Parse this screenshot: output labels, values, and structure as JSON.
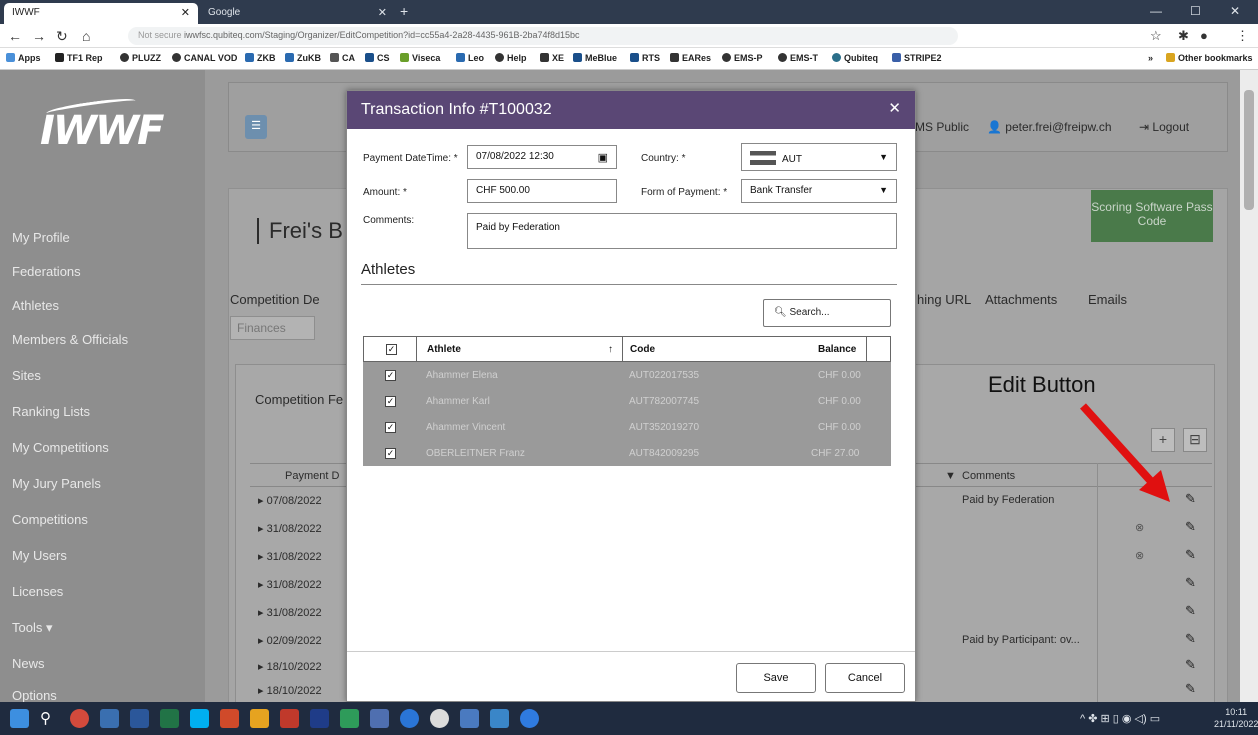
{
  "browser": {
    "tabs": [
      {
        "label": "IWWF",
        "active": true
      },
      {
        "label": "Google",
        "active": false
      }
    ],
    "url_prefix": "Not secure",
    "url": "iwwfsc.qubiteq.com/Staging/Organizer/EditCompetition?id=cc55a4-2a28-4435-961B-2ba74f8d15bc",
    "bookmarks": [
      "Apps",
      "TF1 Rep",
      "PLUZZ",
      "CANAL VOD",
      "ZKB",
      "ZuKB",
      "CA",
      "CS",
      "Viseca",
      "Leo",
      "Help",
      "XE",
      "MeBlue",
      "RTS",
      "EARes",
      "EMS-P",
      "EMS-T",
      "Qubiteq",
      "STRIPE2",
      "»",
      "Other bookmarks"
    ]
  },
  "sidebar": {
    "logo": "IWWF",
    "items": [
      "My Profile",
      "Federations",
      "Athletes",
      "Members & Officials",
      "Sites",
      "Ranking Lists",
      "My Competitions",
      "My Jury Panels",
      "Competitions",
      "My Users",
      "Licenses",
      "Tools ▾",
      "News",
      "Options"
    ]
  },
  "header": {
    "links": [
      "MS Public",
      "peter.frei@freipw.ch",
      "Logout"
    ]
  },
  "page": {
    "title": "Frei's B",
    "scoring_button": "Scoring Software Pass Code",
    "tabs": [
      "Competition De",
      "hing URL",
      "Attachments",
      "Emails"
    ],
    "finances_tab": "Finances",
    "section": "Competition Fe",
    "grid_headers": [
      "Payment D",
      "Comments"
    ],
    "rows": [
      {
        "date": "07/08/2022",
        "comment": "Paid by Federation",
        "has_x": false
      },
      {
        "date": "31/08/2022",
        "comment": "",
        "has_x": true
      },
      {
        "date": "31/08/2022",
        "comment": "",
        "has_x": true
      },
      {
        "date": "31/08/2022",
        "comment": "",
        "has_x": false
      },
      {
        "date": "31/08/2022",
        "comment": "",
        "has_x": false
      },
      {
        "date": "02/09/2022",
        "comment": "Paid by Participant: ov...",
        "has_x": false
      },
      {
        "date": "18/10/2022",
        "comment": "",
        "has_x": false
      },
      {
        "date": "18/10/2022",
        "comment": "",
        "has_x": false
      }
    ]
  },
  "annotation": "Edit Button",
  "modal": {
    "title": "Transaction Info #T100032",
    "labels": {
      "payment_datetime": "Payment DateTime: *",
      "country": "Country: *",
      "amount": "Amount: *",
      "form_of_payment": "Form of Payment: *",
      "comments": "Comments:"
    },
    "values": {
      "payment_datetime": "07/08/2022 12:30",
      "country": "AUT",
      "amount": "CHF 500.00",
      "form_of_payment": "Bank Transfer",
      "comments": "Paid by Federation"
    },
    "athletes_title": "Athletes",
    "search_placeholder": "Search...",
    "table_headers": [
      "Athlete",
      "Code",
      "Balance"
    ],
    "athletes": [
      {
        "name": "Ahammer Elena",
        "code": "AUT022017535",
        "balance": "CHF 0.00"
      },
      {
        "name": "Ahammer Karl",
        "code": "AUT782007745",
        "balance": "CHF 0.00"
      },
      {
        "name": "Ahammer Vincent",
        "code": "AUT352019270",
        "balance": "CHF 0.00"
      },
      {
        "name": "OBERLEITNER Franz",
        "code": "AUT842009295",
        "balance": "CHF 27.00"
      }
    ],
    "save_label": "Save",
    "cancel_label": "Cancel"
  },
  "taskbar": {
    "time": "10:11",
    "date": "21/11/2022"
  }
}
